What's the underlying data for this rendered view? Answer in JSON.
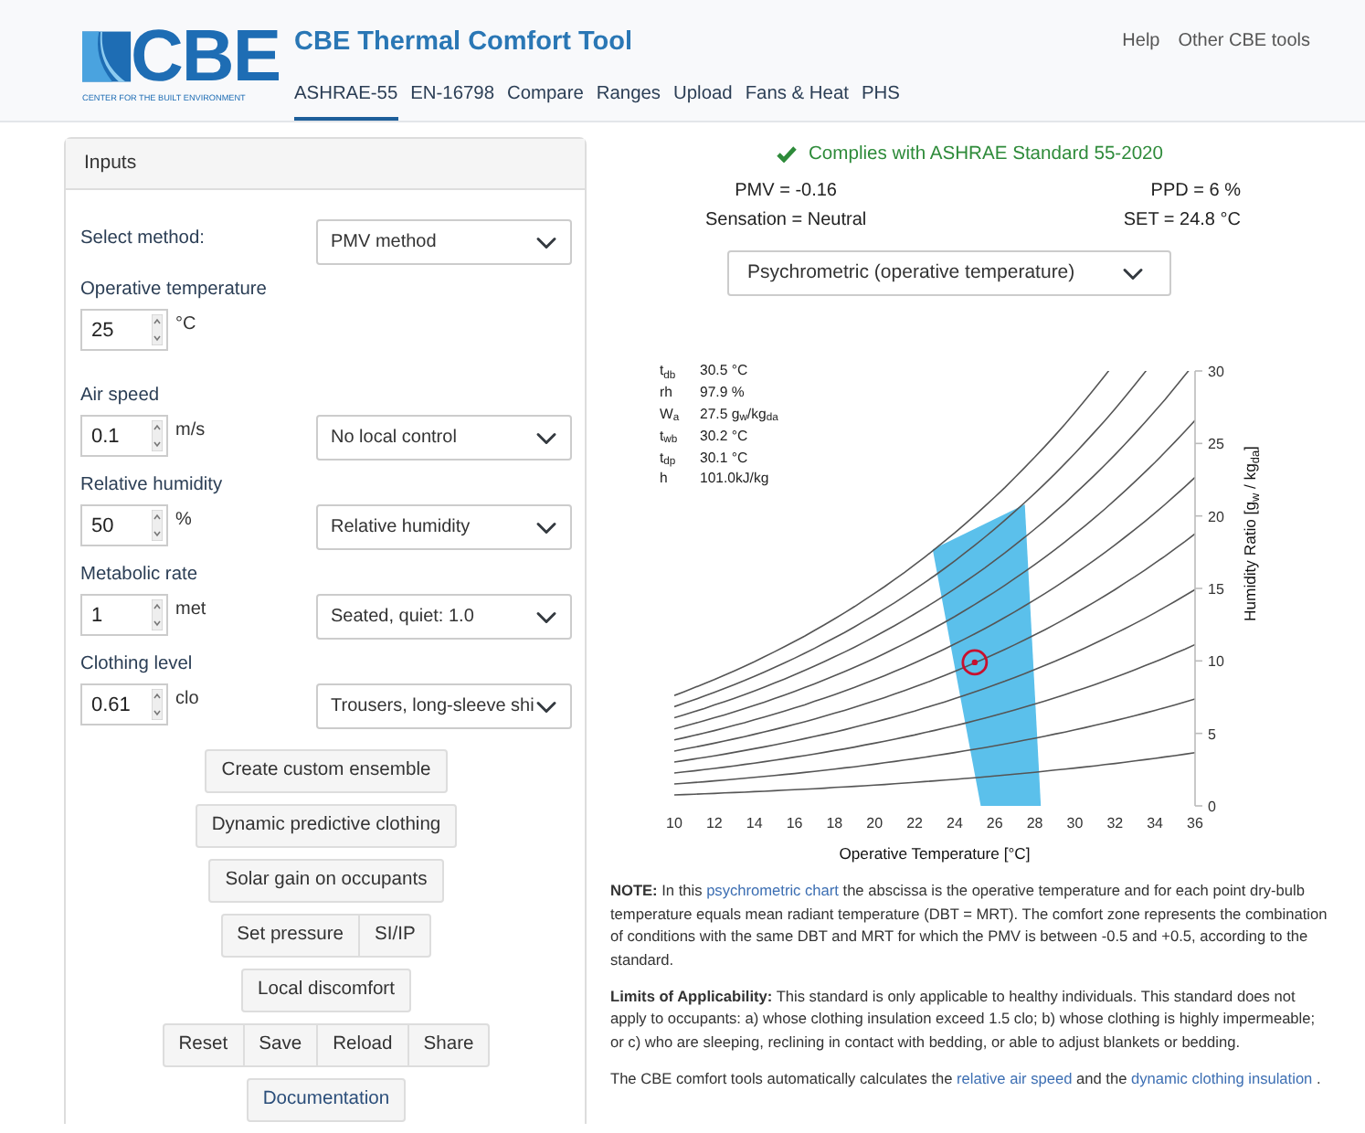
{
  "header": {
    "logo": {
      "mark": "CBE",
      "tagline": "CENTER FOR THE BUILT ENVIRONMENT"
    },
    "title": "CBE Thermal Comfort Tool",
    "nav": [
      {
        "label": "ASHRAE-55",
        "selected": true
      },
      {
        "label": "EN-16798",
        "selected": false
      },
      {
        "label": "Compare",
        "selected": false
      },
      {
        "label": "Ranges",
        "selected": false
      },
      {
        "label": "Upload",
        "selected": false
      },
      {
        "label": "Fans & Heat",
        "selected": false
      },
      {
        "label": "PHS",
        "selected": false
      }
    ],
    "links": [
      "Help",
      "Other CBE tools"
    ]
  },
  "inputs": {
    "title": "Inputs",
    "method": {
      "label": "Select method:",
      "value": "PMV method"
    },
    "fields": [
      {
        "label": "Operative temperature",
        "value": "25",
        "unit": "°C"
      },
      {
        "label": "Air speed",
        "value": "0.1",
        "unit": "m/s",
        "select": "No local control"
      },
      {
        "label": "Relative humidity",
        "value": "50",
        "unit": "%",
        "select": "Relative humidity"
      },
      {
        "label": "Metabolic rate",
        "value": "1",
        "unit": "met",
        "select": "Seated, quiet: 1.0"
      },
      {
        "label": "Clothing level",
        "value": "0.61",
        "unit": "clo",
        "select": "Trousers, long-sleeve shi"
      }
    ],
    "button_groups": [
      [
        "Create custom ensemble"
      ],
      [
        "Dynamic predictive clothing"
      ],
      [
        "Solar gain on occupants"
      ],
      [
        "Set pressure",
        "SI/IP"
      ],
      [
        "Local discomfort"
      ],
      [
        "Reset",
        "Save",
        "Reload",
        "Share"
      ],
      [
        "Documentation"
      ]
    ]
  },
  "compliance": {
    "text": "Complies with ASHRAE Standard 55-2020",
    "complies": true
  },
  "results": {
    "left": [
      "PMV = -0.16",
      "Sensation = Neutral"
    ],
    "right": [
      "PPD = 6 %",
      "SET = 24.8 °C"
    ]
  },
  "chart_select": "Psychrometric (operative temperature)",
  "chart": {
    "legend": [
      {
        "label": "t$_{db}$",
        "value": "30.5 °C"
      },
      {
        "label": "rh",
        "value": "97.9 %"
      },
      {
        "label": "W$_{a}$",
        "value": "27.5 g$_{w}$/kg$_{da}$"
      },
      {
        "label": "t$_{wb}$",
        "value": "30.2 °C"
      },
      {
        "label": "t$_{dp}$",
        "value": "30.1 °C"
      },
      {
        "label": "h",
        "value": "101.0kJ/kg"
      }
    ],
    "chart_data": {
      "type": "scatter",
      "xlabel": "Operative Temperature [°C]",
      "ylabel": "Humidity Ratio [g$_{w}$ / kg$_{da}$]",
      "xlim": [
        10,
        36
      ],
      "ylim": [
        0,
        30
      ],
      "xticks": [
        10,
        12,
        14,
        16,
        18,
        20,
        22,
        24,
        26,
        28,
        30,
        32,
        34,
        36
      ],
      "yticks": [
        0,
        5,
        10,
        15,
        20,
        25,
        30
      ],
      "x": [
        25
      ],
      "series": [
        {
          "color": "#c8102e",
          "values": [
            9.9
          ]
        }
      ]
    }
  },
  "notes": [
    [
      {
        "kind": "text",
        "text": "**NOTE:** In this "
      },
      {
        "kind": "link",
        "text": "psychrometric chart"
      },
      {
        "kind": "text",
        "text": " the abscissa is the operative temperature and for each point dry-bulb temperature equals mean radiant temperature (DBT = MRT). The comfort zone represents the combination of conditions with the same DBT and MRT for which the PMV is between -0.5 and +0.5, according to the standard."
      }
    ],
    [
      {
        "kind": "text",
        "text": "**Limits of Applicability:** This standard is only applicable to healthy individuals. This standard does not apply to occupants: a) whose clothing insulation exceed 1.5 clo; b) whose clothing is highly impermeable; or c) who are sleeping, reclining in contact with bedding, or able to adjust blankets or bedding."
      }
    ],
    [
      {
        "kind": "text",
        "text": "The CBE comfort tools automatically calculates the "
      },
      {
        "kind": "link",
        "text": "relative air speed"
      },
      {
        "kind": "text",
        "text": " and the "
      },
      {
        "kind": "link",
        "text": "dynamic clothing insulation"
      },
      {
        "kind": "text",
        "text": " ."
      }
    ]
  ]
}
